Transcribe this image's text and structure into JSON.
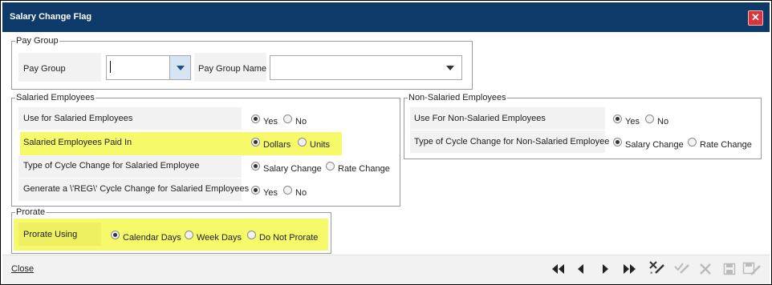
{
  "window": {
    "title": "Salary Change Flag"
  },
  "pay_group": {
    "legend": "Pay Group",
    "pay_group_label": "Pay Group",
    "pay_group_value": "",
    "pay_group_name_label": "Pay Group Name",
    "pay_group_name_value": ""
  },
  "salaried": {
    "legend": "Salaried Employees",
    "rows": [
      {
        "label": "Use for Salaried Employees",
        "options": [
          "Yes",
          "No"
        ],
        "selected": "Yes"
      },
      {
        "label": "Salaried Employees Paid In",
        "options": [
          "Dollars",
          "Units"
        ],
        "selected": "Dollars"
      },
      {
        "label": "Type of Cycle Change for Salaried Employee",
        "options": [
          "Salary Change",
          "Rate Change"
        ],
        "selected": "Salary Change"
      },
      {
        "label": "Generate a \\'REG\\' Cycle Change for Salaried Employees",
        "options": [
          "Yes",
          "No"
        ],
        "selected": "Yes"
      }
    ]
  },
  "non_salaried": {
    "legend": "Non-Salaried Employees",
    "rows": [
      {
        "label": "Use For Non-Salaried Employees",
        "options": [
          "Yes",
          "No"
        ],
        "selected": "Yes"
      },
      {
        "label": "Type of Cycle Change for Non-Salaried Employee",
        "options": [
          "Salary Change",
          "Rate Change"
        ],
        "selected": "Salary Change"
      }
    ]
  },
  "prorate": {
    "legend": "Prorate",
    "label": "Prorate Using",
    "options": [
      "Calendar Days",
      "Week Days",
      "Do Not Prorate"
    ],
    "selected": "Calendar Days"
  },
  "footer": {
    "close_label": "Close",
    "icons": [
      "first-record-icon",
      "previous-record-icon",
      "next-record-icon",
      "last-record-icon",
      "add-edit-icon",
      "confirm-icon",
      "cancel-icon",
      "save-icon",
      "save-edit-icon"
    ]
  },
  "colors": {
    "titlebar": "#0d3a69",
    "highlight": "#f6f96a",
    "close_button": "#d8343a"
  }
}
